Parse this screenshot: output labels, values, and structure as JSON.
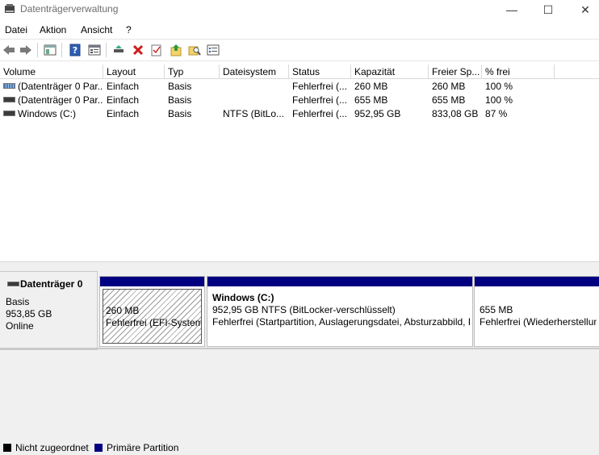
{
  "window": {
    "title": "Datenträgerverwaltung",
    "minimize": "—",
    "maximize": "☐",
    "close": "✕"
  },
  "menu": [
    "Datei",
    "Aktion",
    "Ansicht",
    "?"
  ],
  "toolbar": {
    "icons": [
      "back-icon",
      "forward-icon",
      "console-tree-icon",
      "help-icon",
      "properties-icon",
      "connect-disk-icon",
      "delete-icon",
      "checkmark-icon",
      "folder-up-icon",
      "folder-search-icon",
      "list-icon"
    ]
  },
  "list": {
    "columns": [
      "Volume",
      "Layout",
      "Typ",
      "Dateisystem",
      "Status",
      "Kapazität",
      "Freier Sp...",
      "% frei"
    ],
    "rows": [
      [
        "(Datenträger 0 Par...",
        "Einfach",
        "Basis",
        "",
        "Fehlerfrei (...",
        "260 MB",
        "260 MB",
        "100 %"
      ],
      [
        "(Datenträger 0 Par...",
        "Einfach",
        "Basis",
        "",
        "Fehlerfrei (...",
        "655 MB",
        "655 MB",
        "100 %"
      ],
      [
        "Windows (C:)",
        "Einfach",
        "Basis",
        "NTFS (BitLo...",
        "Fehlerfrei (...",
        "952,95 GB",
        "833,08 GB",
        "87 %"
      ]
    ]
  },
  "disk": {
    "name": "Datenträger 0",
    "type": "Basis",
    "size": "953,85 GB",
    "state": "Online"
  },
  "partitions": [
    {
      "title": "",
      "line1": "260 MB",
      "line2": "Fehlerfrei (EFI-Systempartition)"
    },
    {
      "title": "Windows  (C:)",
      "line1": "952,95 GB NTFS (BitLocker-verschlüsselt)",
      "line2": "Fehlerfrei (Startpartition, Auslagerungsdatei, Absturzabbild, Primäre Partition)"
    },
    {
      "title": "",
      "line1": "655 MB",
      "line2": "Fehlerfrei (Wiederherstellungspartition)"
    }
  ],
  "legend": {
    "unallocated": "Nicht zugeordnet",
    "primary": "Primäre Partition",
    "unallocated_color": "#000000",
    "primary_color": "#000080"
  }
}
